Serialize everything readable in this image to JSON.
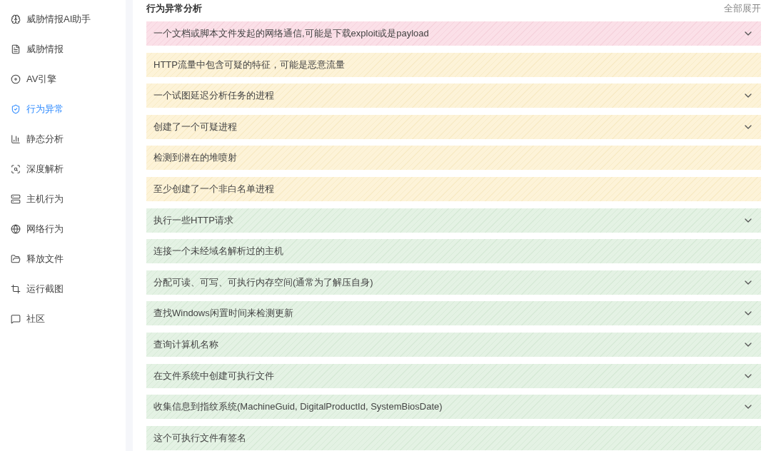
{
  "sidebar": {
    "items": [
      {
        "label": "威胁情报AI助手",
        "selected": false
      },
      {
        "label": "威胁情报",
        "selected": false
      },
      {
        "label": "AV引擎",
        "selected": false
      },
      {
        "label": "行为异常",
        "selected": true
      },
      {
        "label": "静态分析",
        "selected": false
      },
      {
        "label": "深度解析",
        "selected": false
      },
      {
        "label": "主机行为",
        "selected": false
      },
      {
        "label": "网络行为",
        "selected": false
      },
      {
        "label": "释放文件",
        "selected": false
      },
      {
        "label": "运行截图",
        "selected": false
      },
      {
        "label": "社区",
        "selected": false
      }
    ]
  },
  "section": {
    "title": "行为异常分析",
    "expand_all": "全部展开",
    "rows": [
      {
        "text": "一个文档或脚本文件发起的网络通信,可能是下载exploit或是payload",
        "kind": "high",
        "expandable": true
      },
      {
        "text": "HTTP流量中包含可疑的特征，可能是恶意流量",
        "kind": "medium",
        "expandable": false
      },
      {
        "text": "一个试图延迟分析任务的进程",
        "kind": "medium",
        "expandable": true
      },
      {
        "text": "创建了一个可疑进程",
        "kind": "medium",
        "expandable": true
      },
      {
        "text": "检测到潜在的堆喷射",
        "kind": "medium",
        "expandable": false
      },
      {
        "text": "至少创建了一个非白名单进程",
        "kind": "medium",
        "expandable": false
      },
      {
        "text": "执行一些HTTP请求",
        "kind": "low",
        "expandable": true
      },
      {
        "text": "连接一个未经域名解析过的主机",
        "kind": "low",
        "expandable": false
      },
      {
        "text": "分配可读、可写、可执行内存空间(通常为了解压自身)",
        "kind": "low",
        "expandable": true
      },
      {
        "text": "查找Windows闲置时间来检测更新",
        "kind": "low",
        "expandable": true
      },
      {
        "text": "查询计算机名称",
        "kind": "low",
        "expandable": true
      },
      {
        "text": "在文件系统中创建可执行文件",
        "kind": "low",
        "expandable": true
      },
      {
        "text": "收集信息到指纹系统(MachineGuid, DigitalProductId, SystemBiosDate)",
        "kind": "low",
        "expandable": true
      },
      {
        "text": "这个可执行文件有签名",
        "kind": "low",
        "expandable": false
      }
    ]
  }
}
